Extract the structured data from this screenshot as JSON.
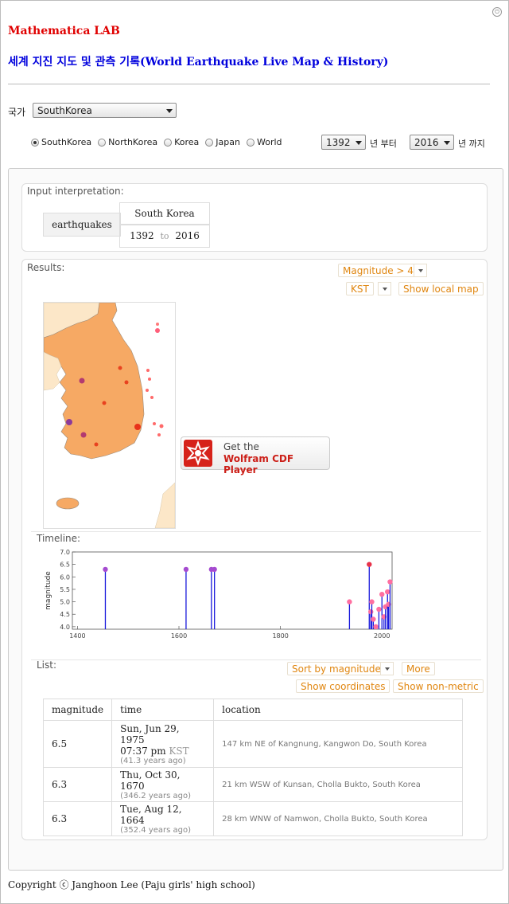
{
  "header": {
    "title": "Mathematica LAB",
    "subtitle": "세계 지진 지도 및 관측 기록(World Earthquake Live Map & History)"
  },
  "controls": {
    "country_label": "국가",
    "country_value": "SouthKorea",
    "radios": [
      {
        "label": "SouthKorea",
        "selected": true
      },
      {
        "label": "NorthKorea",
        "selected": false
      },
      {
        "label": "Korea",
        "selected": false
      },
      {
        "label": "Japan",
        "selected": false
      },
      {
        "label": "World",
        "selected": false
      }
    ],
    "year_from": "1392",
    "year_from_label": "년 부터",
    "year_to": "2016",
    "year_to_label": "년 까지"
  },
  "interpretation": {
    "label": "Input interpretation:",
    "query": "earthquakes",
    "region": "South Korea",
    "from": "1392",
    "to_word": "to",
    "to": "2016"
  },
  "results": {
    "label": "Results:",
    "magnitude_btn": "Magnitude > 4",
    "kst_btn": "KST",
    "local_map_btn": "Show local map",
    "cdf_line1": "Get the",
    "cdf_line2": "Wolfram CDF Player"
  },
  "timeline": {
    "label": "Timeline:"
  },
  "chart_data": {
    "type": "scatter",
    "ylabel": "magnitude",
    "xlim": [
      1390,
      2020
    ],
    "ylim": [
      3.9,
      7.0
    ],
    "xticks": [
      1400,
      1600,
      1800,
      2000
    ],
    "yticks": [
      4.0,
      4.5,
      5.0,
      5.5,
      6.0,
      6.5,
      7.0
    ],
    "points": [
      {
        "x": 1455,
        "y": 6.3
      },
      {
        "x": 1614,
        "y": 6.3
      },
      {
        "x": 1664,
        "y": 6.3
      },
      {
        "x": 1670,
        "y": 6.3
      },
      {
        "x": 1936,
        "y": 5.0
      },
      {
        "x": 1975,
        "y": 6.5
      },
      {
        "x": 1978,
        "y": 4.6
      },
      {
        "x": 1980,
        "y": 5.0
      },
      {
        "x": 1983,
        "y": 4.3
      },
      {
        "x": 1988,
        "y": 4.0
      },
      {
        "x": 1994,
        "y": 4.7
      },
      {
        "x": 2000,
        "y": 5.3
      },
      {
        "x": 2004,
        "y": 4.4
      },
      {
        "x": 2007,
        "y": 4.8
      },
      {
        "x": 2011,
        "y": 5.4
      },
      {
        "x": 2013,
        "y": 4.9
      },
      {
        "x": 2016,
        "y": 5.8
      }
    ]
  },
  "list": {
    "label": "List:",
    "sort_btn": "Sort by magnitude",
    "more_btn": "More",
    "coords_btn": "Show coordinates",
    "nonmetric_btn": "Show non-metric",
    "headers": [
      "magnitude",
      "time",
      "location"
    ],
    "rows": [
      {
        "magnitude": "6.5",
        "date": "Sun, Jun 29, 1975",
        "clock": "07:37 pm",
        "tz": "KST",
        "ago": "(41.3 years ago)",
        "location": "147 km NE of Kangnung, Kangwon Do, South Korea"
      },
      {
        "magnitude": "6.3",
        "date": "Thu, Oct 30, 1670",
        "clock": "",
        "tz": "",
        "ago": "(346.2 years ago)",
        "location": "21 km WSW of Kunsan, Cholla Bukto, South Korea"
      },
      {
        "magnitude": "6.3",
        "date": "Tue, Aug 12, 1664",
        "clock": "",
        "tz": "",
        "ago": "(352.4 years ago)",
        "location": "28 km WNW of Namwon, Cholla Bukto, South Korea"
      }
    ]
  },
  "footer": {
    "copyright": "Copyright ⓒ Janghoon Lee (Paju girls' high school)"
  }
}
